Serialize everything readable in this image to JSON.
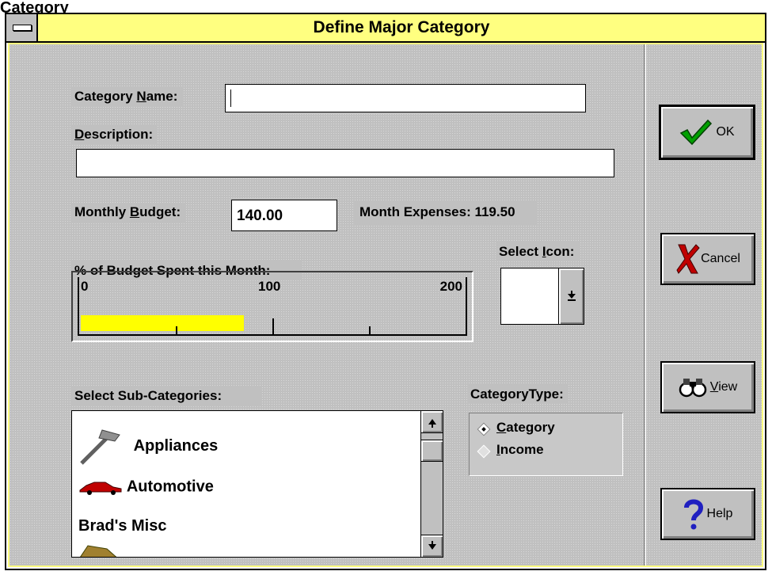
{
  "clipped_header": "Category",
  "window": {
    "title": "Define  Major Category"
  },
  "form": {
    "category_name": {
      "label_pre": "Category ",
      "label_key": "N",
      "label_post": "ame:",
      "value": ""
    },
    "description": {
      "label_key": "D",
      "label_post": "escription:",
      "value": ""
    },
    "monthly_budget": {
      "label_pre": "Monthly ",
      "label_key": "B",
      "label_post": "udget:",
      "value": "140.00"
    },
    "month_expenses": "Month Expenses: 119.50",
    "gauge": {
      "label": "% of Budget Spent this Month:",
      "scale_labels": [
        "0",
        "100",
        "200"
      ],
      "percent_spent": 85,
      "scale_max": 200,
      "fill_color": "#ffff00"
    },
    "select_icon": {
      "label_pre": "Select ",
      "label_key": "I",
      "label_post": "con:"
    },
    "sub_categories": {
      "label": "Select Sub-Categories:",
      "items": [
        "Appliances",
        "Automotive",
        "Brad's Misc"
      ]
    },
    "category_type": {
      "label": "CategoryType:",
      "options": [
        {
          "key": "C",
          "rest": "ategory",
          "selected": true
        },
        {
          "key": "I",
          "rest": "ncome",
          "selected": false
        }
      ]
    }
  },
  "buttons": {
    "ok": {
      "label": "OK",
      "icon": "checkmark-icon"
    },
    "cancel": {
      "label": "Cancel",
      "icon": "x-icon"
    },
    "view": {
      "key": "V",
      "rest": "iew",
      "icon": "binoculars-icon"
    },
    "help": {
      "label": "Help",
      "icon": "question-icon"
    }
  },
  "colors": {
    "titlebar": "#ffff80",
    "face": "#c0c0c0",
    "check": "#00a000",
    "x": "#c00000",
    "help": "#2020c0"
  }
}
